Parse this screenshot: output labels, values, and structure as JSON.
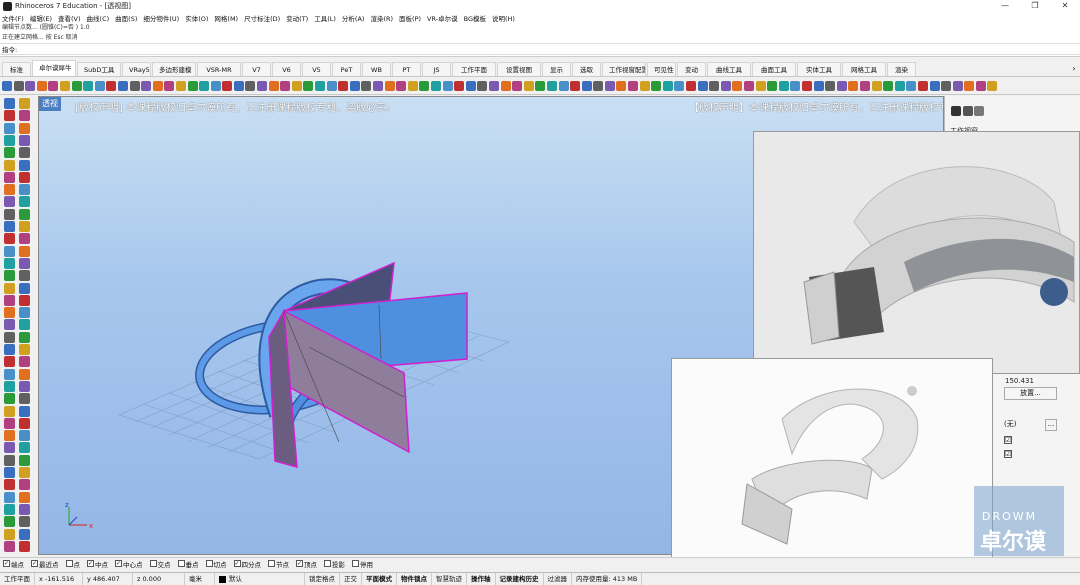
{
  "window": {
    "title": "Rhinoceros 7 Education - [透视图]",
    "controls": [
      "—",
      "❐",
      "✕"
    ]
  },
  "menu": [
    "文件(F)",
    "编辑(E)",
    "查看(V)",
    "曲线(C)",
    "曲面(S)",
    "细分物件(U)",
    "实体(O)",
    "网格(M)",
    "尺寸标注(D)",
    "变动(T)",
    "工具(L)",
    "分析(A)",
    "渲染(R)",
    "面板(P)",
    "VR-卓尔谟",
    "BG模板",
    "说明(H)"
  ],
  "command": {
    "history1": "编辑节点数... (圆锥(C)=否 ) 1.0",
    "history2": "正在建立网格... 按 Esc 取消",
    "prompt": "指令:",
    "value": ""
  },
  "tabs": [
    "标准",
    "卓尔谟犀牛",
    "SubD工具",
    "VRay5",
    "多边形建模",
    "VSR-MR",
    "V7",
    "V6",
    "V5",
    "PeT",
    "WB",
    "PT",
    "JS",
    "工作平面",
    "设置视图",
    "显示",
    "选取",
    "工作视窗配置",
    "可见性",
    "变动",
    "曲线工具",
    "曲面工具",
    "实体工具",
    "网格工具",
    "渲染"
  ],
  "active_tab": "卓尔谟犀牛",
  "viewport": {
    "label": "透视",
    "watermark_left": "[版权声明] 本课程版权归卓尔谟所有，已注册课程版权专利，盗版必究!",
    "watermark_right": "【版权声明】本课程版权归卓尔谟所有，已注册课程版权专利，盗版必究!",
    "axis_y": "y",
    "axis_z": "z",
    "axis_x": "x"
  },
  "right_panel": {
    "title": "工作视窗",
    "value": "150.431",
    "place_button": "放置...",
    "none_value": "(无)",
    "more_button": "...",
    "check1": "☑",
    "check2": "☑"
  },
  "logo": {
    "top": "DROWM",
    "main": "卓尔谟"
  },
  "osnaps": [
    {
      "label": "端点",
      "checked": true
    },
    {
      "label": "最近点",
      "checked": true
    },
    {
      "label": "点",
      "checked": false
    },
    {
      "label": "中点",
      "checked": true
    },
    {
      "label": "中心点",
      "checked": true
    },
    {
      "label": "交点",
      "checked": false
    },
    {
      "label": "垂点",
      "checked": false
    },
    {
      "label": "切点",
      "checked": false
    },
    {
      "label": "四分点",
      "checked": true
    },
    {
      "label": "节点",
      "checked": false
    },
    {
      "label": "顶点",
      "checked": true
    },
    {
      "label": "投影",
      "checked": false
    },
    {
      "label": "停用",
      "checked": false
    }
  ],
  "status": {
    "cplane": "工作平面",
    "x": "x -161.516",
    "y": "y 486.407",
    "z": "z 0.000",
    "unit": "毫米",
    "layer": "默认",
    "items": [
      "锁定格点",
      "正交",
      "平面模式",
      "物件锁点",
      "智慧轨迹",
      "操作轴",
      "记录建构历史",
      "过滤器"
    ],
    "memory": "内存使用量: 413 MB"
  },
  "colors": {
    "accent": "#4b7ec0",
    "model_blue": "#4f8fe0",
    "surface_mauve": "#8f7d9c",
    "edge_magenta": "#d020d0"
  }
}
